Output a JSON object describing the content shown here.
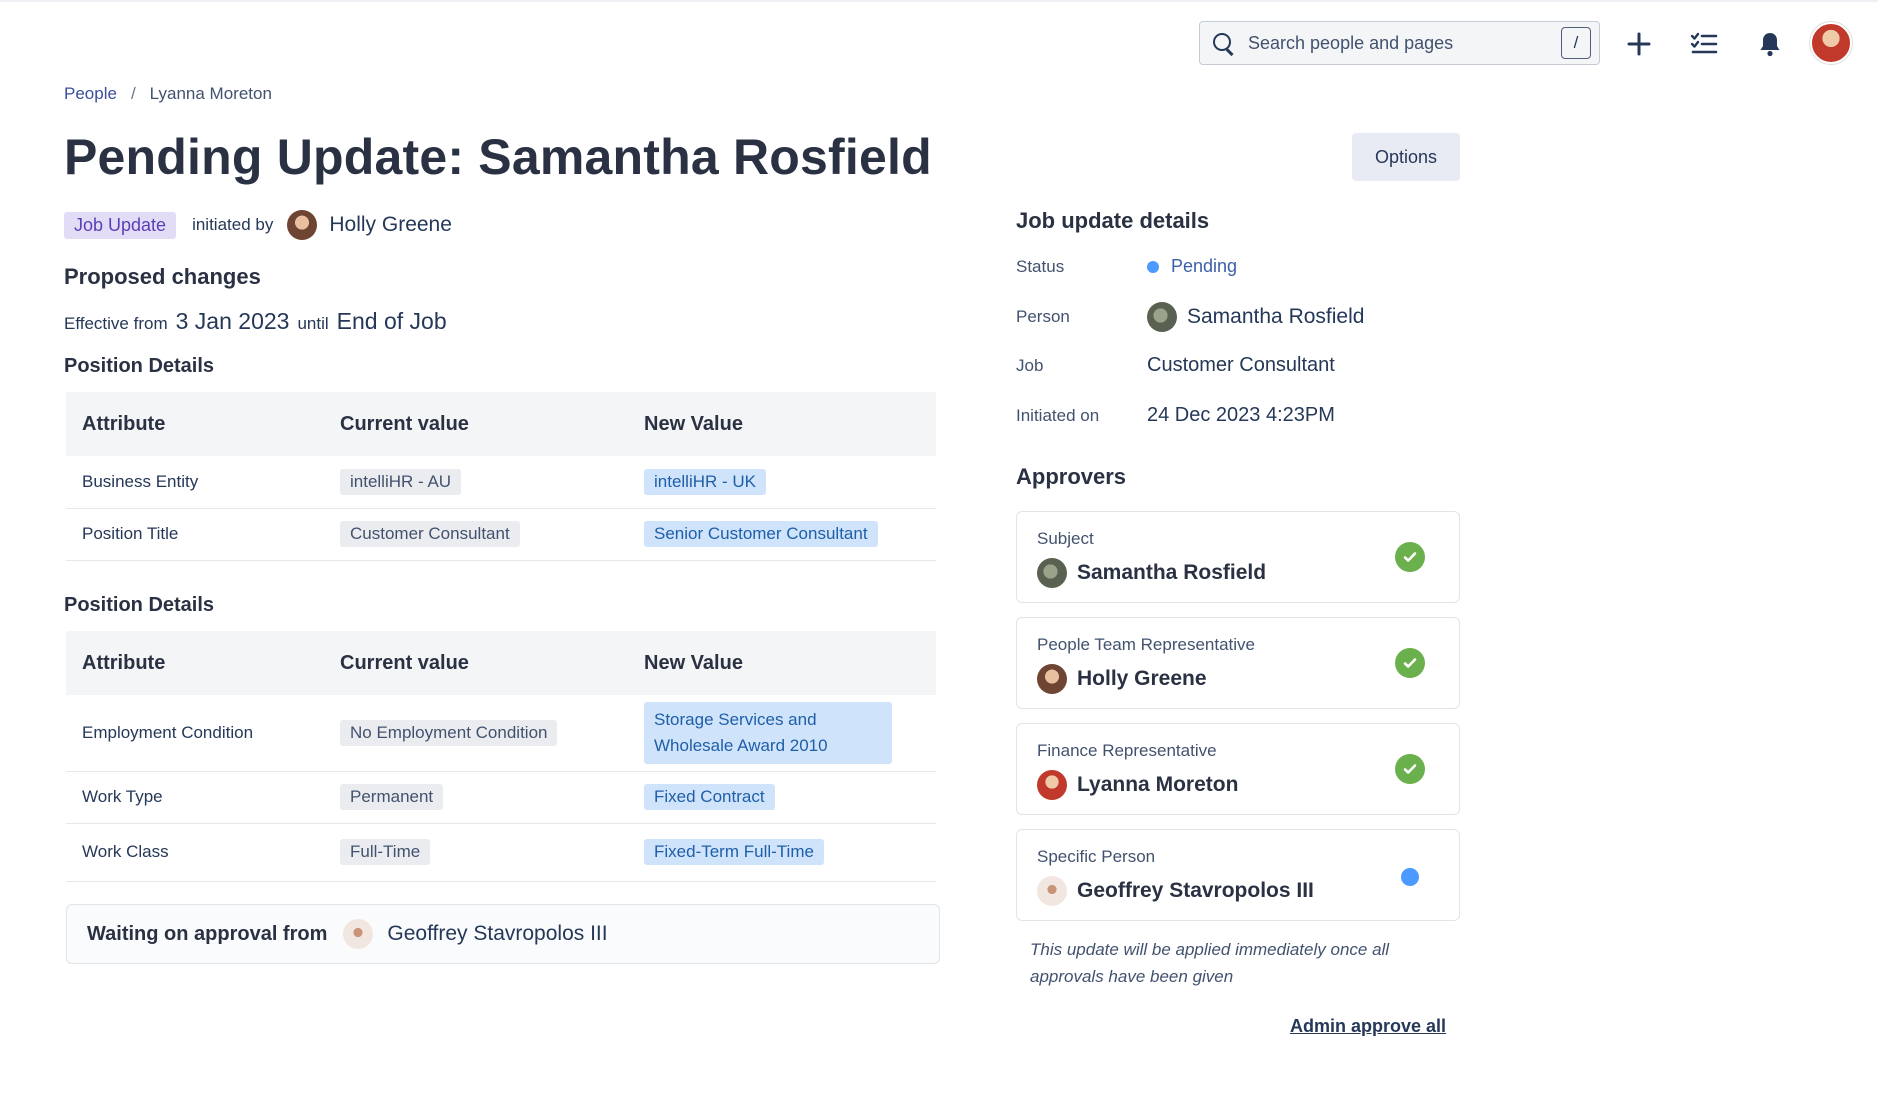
{
  "topbar": {
    "search_placeholder": "Search people and pages",
    "search_shortcut": "/",
    "icons": [
      "plus-icon",
      "tasks-icon",
      "bell-icon",
      "user-avatar"
    ]
  },
  "breadcrumb": {
    "root": "People",
    "separator": "/",
    "current": "Lyanna Moreton"
  },
  "page_title": "Pending Update: Samantha Rosfield",
  "options_label": "Options",
  "meta": {
    "tag": "Job Update",
    "initiated_by_label": "initiated by",
    "initiator": "Holly Greene"
  },
  "proposed": {
    "heading": "Proposed changes",
    "effective_from_label": "Effective from",
    "effective_from": "3 Jan 2023",
    "until_label": "until",
    "until": "End of Job"
  },
  "tables": [
    {
      "heading": "Position Details",
      "columns": [
        "Attribute",
        "Current value",
        "New Value"
      ],
      "rows": [
        {
          "attribute": "Business Entity",
          "current": "intelliHR - AU",
          "new": "intelliHR - UK"
        },
        {
          "attribute": "Position Title",
          "current": "Customer Consultant",
          "new": "Senior Customer Consultant"
        }
      ]
    },
    {
      "heading": "Position Details",
      "columns": [
        "Attribute",
        "Current value",
        "New Value"
      ],
      "rows": [
        {
          "attribute": "Employment Condition",
          "current": "No Employment Condition",
          "new": "Storage Services and Wholesale Award 2010"
        },
        {
          "attribute": "Work Type",
          "current": "Permanent",
          "new": "Fixed Contract"
        },
        {
          "attribute": "Work Class",
          "current": "Full-Time",
          "new": "Fixed-Term Full-Time"
        }
      ]
    }
  ],
  "waiting": {
    "label": "Waiting on approval from",
    "name": "Geoffrey Stavropolos III"
  },
  "details": {
    "heading": "Job update details",
    "status_label": "Status",
    "status": "Pending",
    "status_color": "#4c9aff",
    "person_label": "Person",
    "person": "Samantha Rosfield",
    "job_label": "Job",
    "job": "Customer Consultant",
    "initiated_label": "Initiated on",
    "initiated": "24 Dec 2023 4:23PM"
  },
  "approvers": {
    "heading": "Approvers",
    "items": [
      {
        "role": "Subject",
        "name": "Samantha Rosfield",
        "state": "approved"
      },
      {
        "role": "People Team Representative",
        "name": "Holly Greene",
        "state": "approved"
      },
      {
        "role": "Finance Representative",
        "name": "Lyanna Moreton",
        "state": "approved"
      },
      {
        "role": "Specific Person",
        "name": "Geoffrey Stavropolos III",
        "state": "pending"
      }
    ],
    "note": "This update will be applied immediately once all approvals have been given",
    "admin_link": "Admin approve all"
  },
  "colors": {
    "approved": "#6ab04c",
    "pending": "#4c9aff",
    "tag_bg": "#e3dcf7",
    "new_value_bg": "#cfe3fb"
  }
}
